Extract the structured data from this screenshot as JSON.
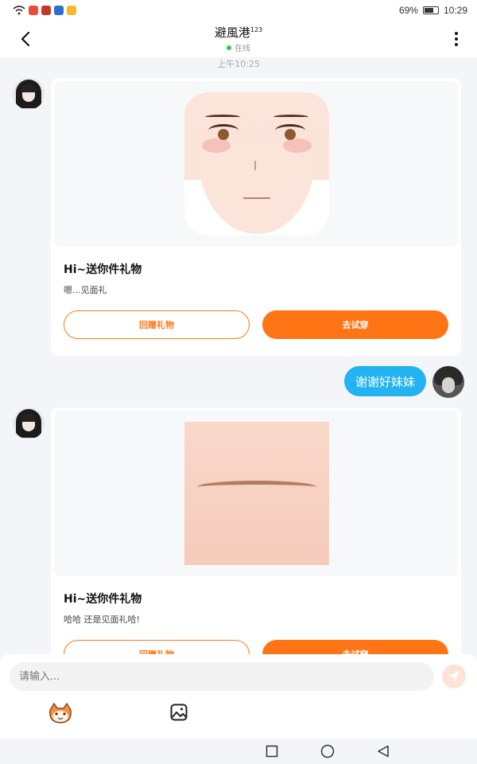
{
  "status_bar": {
    "battery": "69%",
    "time": "10:29"
  },
  "header": {
    "title": "避風港",
    "title_sup": "123",
    "status": "在线"
  },
  "chat": {
    "timestamp": "上午10:25",
    "gift_card_1": {
      "title": "Hi~送你件礼物",
      "subtitle": "嗯...见面礼",
      "return_label": "回赠礼物",
      "try_label": "去试穿"
    },
    "my_message": "谢谢好妹妹",
    "gift_card_2": {
      "title": "Hi~送你件礼物",
      "subtitle": "哈哈 还是见面礼哈!",
      "return_label": "回赠礼物",
      "try_label": "去试穿"
    }
  },
  "input": {
    "placeholder": "请输入..."
  },
  "colors": {
    "accent": "#ff7415",
    "bubble": "#22b3f0",
    "online": "#2ecc40"
  },
  "icons": [
    "back-icon",
    "more-icon",
    "send-icon",
    "emoji-icon",
    "image-icon",
    "square-nav-icon",
    "circle-nav-icon",
    "triangle-nav-icon"
  ]
}
